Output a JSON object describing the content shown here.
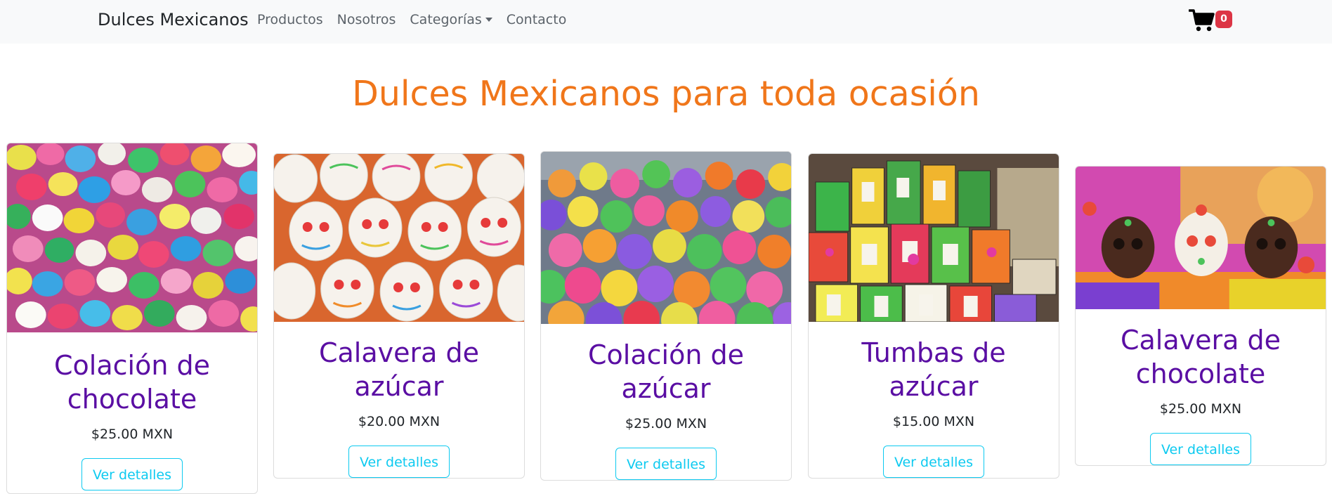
{
  "nav": {
    "brand": "Dulces Mexicanos",
    "links": [
      "Productos",
      "Nosotros",
      "Categorías",
      "Contacto"
    ],
    "cart_count": "0"
  },
  "hero": {
    "title": "Dulces Mexicanos para toda ocasión"
  },
  "products": [
    {
      "title": "Colación de chocolate",
      "price": "$25.00 MXN",
      "button": "Ver detalles",
      "image": "colorful-candy-pile"
    },
    {
      "title": "Calavera de azúcar",
      "price": "$20.00 MXN",
      "button": "Ver detalles",
      "image": "sugar-skulls"
    },
    {
      "title": "Colación de azúcar",
      "price": "$25.00 MXN",
      "button": "Ver detalles",
      "image": "sugar-candy-balls"
    },
    {
      "title": "Tumbas de azúcar",
      "price": "$15.00 MXN",
      "button": "Ver detalles",
      "image": "sugar-tombs"
    },
    {
      "title": "Calavera de chocolate",
      "price": "$25.00 MXN",
      "button": "Ver detalles",
      "image": "chocolate-skulls"
    }
  ],
  "colors": {
    "accent_title": "#f0761a",
    "product_title": "#5a0ea3",
    "button": "#0dcaf0",
    "badge": "#dc3545"
  }
}
